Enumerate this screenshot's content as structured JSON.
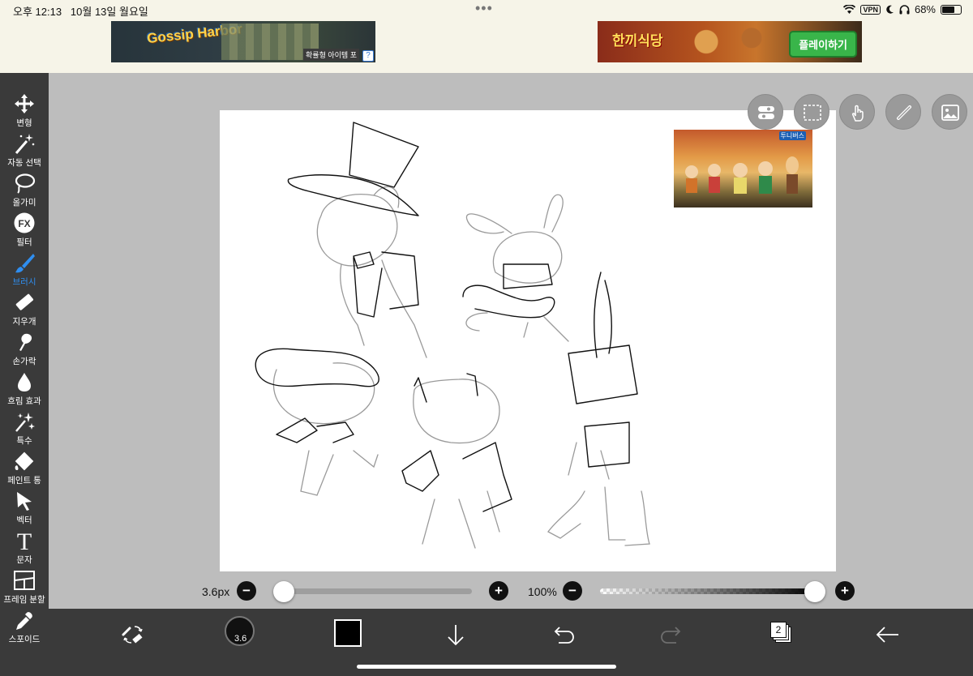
{
  "status_bar": {
    "time": "오후 12:13",
    "date": "10월 13일 월요일",
    "dots": "•••",
    "vpn": "VPN",
    "battery": "68%",
    "battery_level": 0.68
  },
  "ads": {
    "left": {
      "logo": "Gossip Harbor",
      "subtext": "확률형 아이템 포",
      "info_icon": "?"
    },
    "right": {
      "logo": "한끼식당",
      "cta": "플레이하기"
    }
  },
  "tools": [
    {
      "id": "transform",
      "label": "변형",
      "icon": "move-icon"
    },
    {
      "id": "magic-wand",
      "label": "자동 선택",
      "icon": "magic-wand-icon"
    },
    {
      "id": "lasso",
      "label": "올가미",
      "icon": "lasso-icon"
    },
    {
      "id": "filter",
      "label": "필터",
      "icon": "fx-icon",
      "icon_text": "FX"
    },
    {
      "id": "brush",
      "label": "브러시",
      "icon": "brush-icon",
      "active": true
    },
    {
      "id": "eraser",
      "label": "지우개",
      "icon": "eraser-icon"
    },
    {
      "id": "smudge",
      "label": "손가락",
      "icon": "finger-icon"
    },
    {
      "id": "blur",
      "label": "흐림 효과",
      "icon": "drop-icon"
    },
    {
      "id": "special",
      "label": "특수",
      "icon": "sparkle-icon"
    },
    {
      "id": "fill",
      "label": "페인트 통",
      "icon": "paint-bucket-icon"
    },
    {
      "id": "vector",
      "label": "벡터",
      "icon": "cursor-icon"
    },
    {
      "id": "text",
      "label": "문자",
      "icon": "text-icon",
      "icon_text": "T"
    },
    {
      "id": "frame",
      "label": "프레임 분할",
      "icon": "frame-icon"
    },
    {
      "id": "eyedropper",
      "label": "스포이드",
      "icon": "eyedropper-icon"
    }
  ],
  "canvas_controls": [
    "toggle-icon",
    "selection-icon",
    "touch-icon",
    "ruler-icon",
    "image-icon"
  ],
  "reference_image": {
    "logo": "투니버스"
  },
  "brush_size": {
    "label": "3.6px",
    "value": 3.6,
    "fraction": 0.05,
    "minus": "−",
    "plus": "+"
  },
  "opacity": {
    "label": "100%",
    "value": 100,
    "fraction": 1.0,
    "minus": "−",
    "plus": "+"
  },
  "bottom_bar": {
    "brush_size_label": "3.6",
    "color": "#000000",
    "layers_count": "2"
  },
  "colors": {
    "toolbar_bg": "#3a3a3a",
    "accent": "#2f8ef0",
    "canvas_bg": "#ffffff",
    "workspace_bg": "#bdbdbd"
  }
}
